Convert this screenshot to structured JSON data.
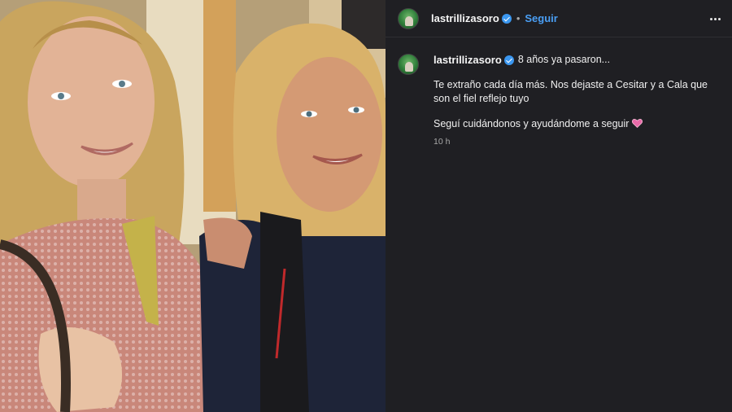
{
  "post": {
    "username": "lastrillizasoro",
    "follow_label": "Seguir",
    "dot": "•",
    "caption": {
      "intro": "8 años ya pasaron...",
      "paragraph1": "Te extraño cada día más. Nos dejaste a Cesitar y a Cala que son el fiel reflejo tuyo",
      "paragraph2": "Seguí cuidándonos y ayudándome a seguir",
      "timestamp": "10 h"
    }
  },
  "colors": {
    "background": "#1f1f23",
    "follow": "#4a9ff5",
    "verified": "#3b97f0",
    "heart": "#e86aa8"
  },
  "icons": [
    "verified-badge-icon",
    "more-options-icon",
    "heart-emoji-icon"
  ]
}
